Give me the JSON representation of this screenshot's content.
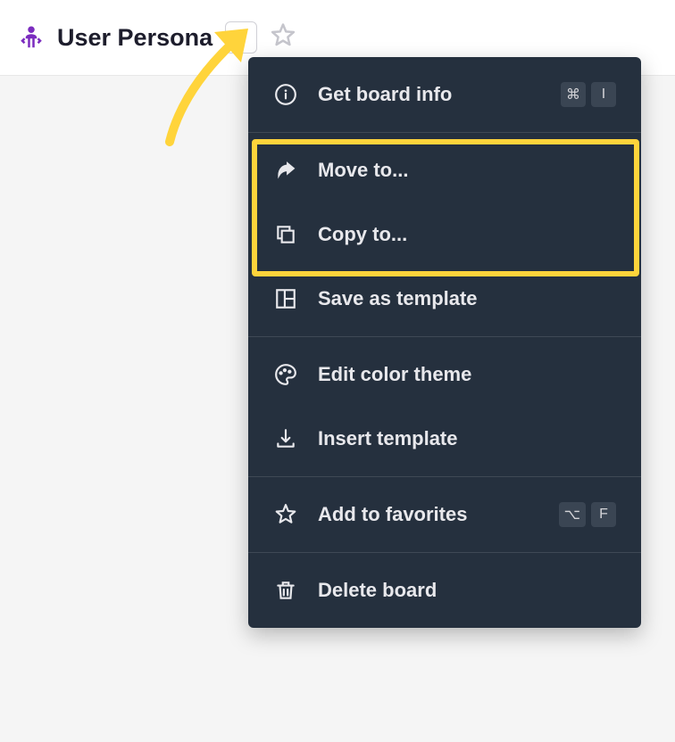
{
  "header": {
    "title": "User Persona"
  },
  "menu": {
    "section1": {
      "get_info": {
        "label": "Get board info",
        "keys": [
          "⌘",
          "I"
        ]
      }
    },
    "section2": {
      "move_to": {
        "label": "Move to..."
      },
      "copy_to": {
        "label": "Copy to..."
      },
      "save_template": {
        "label": "Save as template"
      }
    },
    "section3": {
      "edit_color": {
        "label": "Edit color theme"
      },
      "insert_template": {
        "label": "Insert template"
      }
    },
    "section4": {
      "add_favorites": {
        "label": "Add to favorites",
        "keys": [
          "⌥",
          "F"
        ]
      }
    },
    "section5": {
      "delete_board": {
        "label": "Delete board"
      }
    }
  },
  "colors": {
    "accent_purple": "#7b2cbf",
    "menu_bg": "#25303e",
    "annotation_yellow": "#ffd43b"
  }
}
